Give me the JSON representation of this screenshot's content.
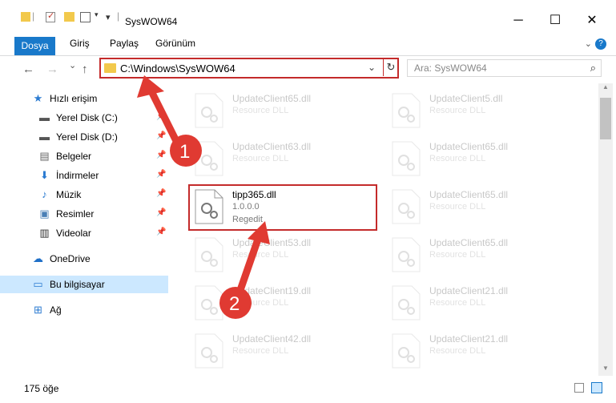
{
  "titlebar": {
    "title": "SysWOW64",
    "minimize": "─",
    "maximize": "☐",
    "close": "✕"
  },
  "ribbon": {
    "tabs": [
      "Dosya",
      "Giriş",
      "Paylaş",
      "Görünüm"
    ],
    "help": "?"
  },
  "nav": {
    "back": "←",
    "forward": "→",
    "recent": "⌄",
    "up": "↑"
  },
  "address": {
    "path": "C:\\Windows\\SysWOW64",
    "chevron": "⌄",
    "refresh": "↻"
  },
  "search": {
    "placeholder": "Ara: SysWOW64",
    "icon": "search-icon"
  },
  "sidebar": {
    "items": [
      {
        "label": "Hızlı erişim",
        "icon": "star-icon",
        "pinned": false
      },
      {
        "label": "Yerel Disk (C:)",
        "icon": "drive-icon",
        "pinned": true
      },
      {
        "label": "Yerel Disk (D:)",
        "icon": "drive-icon",
        "pinned": true
      },
      {
        "label": "Belgeler",
        "icon": "document-icon",
        "pinned": true
      },
      {
        "label": "İndirmeler",
        "icon": "download-icon",
        "pinned": true
      },
      {
        "label": "Müzik",
        "icon": "music-icon",
        "pinned": true
      },
      {
        "label": "Resimler",
        "icon": "picture-icon",
        "pinned": true
      },
      {
        "label": "Videolar",
        "icon": "video-icon",
        "pinned": true
      },
      {
        "label": "OneDrive",
        "icon": "cloud-icon",
        "pinned": false
      },
      {
        "label": "Bu bilgisayar",
        "icon": "computer-icon",
        "pinned": false
      },
      {
        "label": "Ağ",
        "icon": "network-icon",
        "pinned": false
      }
    ]
  },
  "files": {
    "left": [
      {
        "name": "UpdateClient65.dll",
        "desc": "Resource DLL"
      },
      {
        "name": "UpdateClient63.dll",
        "desc": "Resource DLL"
      },
      {
        "name": "tipp365.dll",
        "desc": "1.0.0.0",
        "desc2": "Regedit"
      },
      {
        "name": "UpdateClient53.dll",
        "desc": "Resource DLL"
      },
      {
        "name": "UpdateClient19.dll",
        "desc": "Resource DLL"
      },
      {
        "name": "UpdateClient42.dll",
        "desc": "Resource DLL"
      }
    ],
    "right": [
      {
        "name": "UpdateClient5.dll",
        "desc": "Resource DLL"
      },
      {
        "name": "UpdateClient65.dll",
        "desc": "Resource DLL"
      },
      {
        "name": "UpdateClient65.dll",
        "desc": "Resource DLL"
      },
      {
        "name": "UpdateClient65.dll",
        "desc": "Resource DLL"
      },
      {
        "name": "UpdateClient21.dll",
        "desc": "Resource DLL"
      },
      {
        "name": "UpdateClient21.dll",
        "desc": "Resource DLL"
      }
    ]
  },
  "status": {
    "count": "175 öğe"
  },
  "annotations": {
    "step1": "1",
    "step2": "2",
    "color": "#e03a32"
  },
  "colors": {
    "accent": "#1979ca",
    "highlight_border": "#c42b2b",
    "selected_bg": "#cce8ff"
  }
}
